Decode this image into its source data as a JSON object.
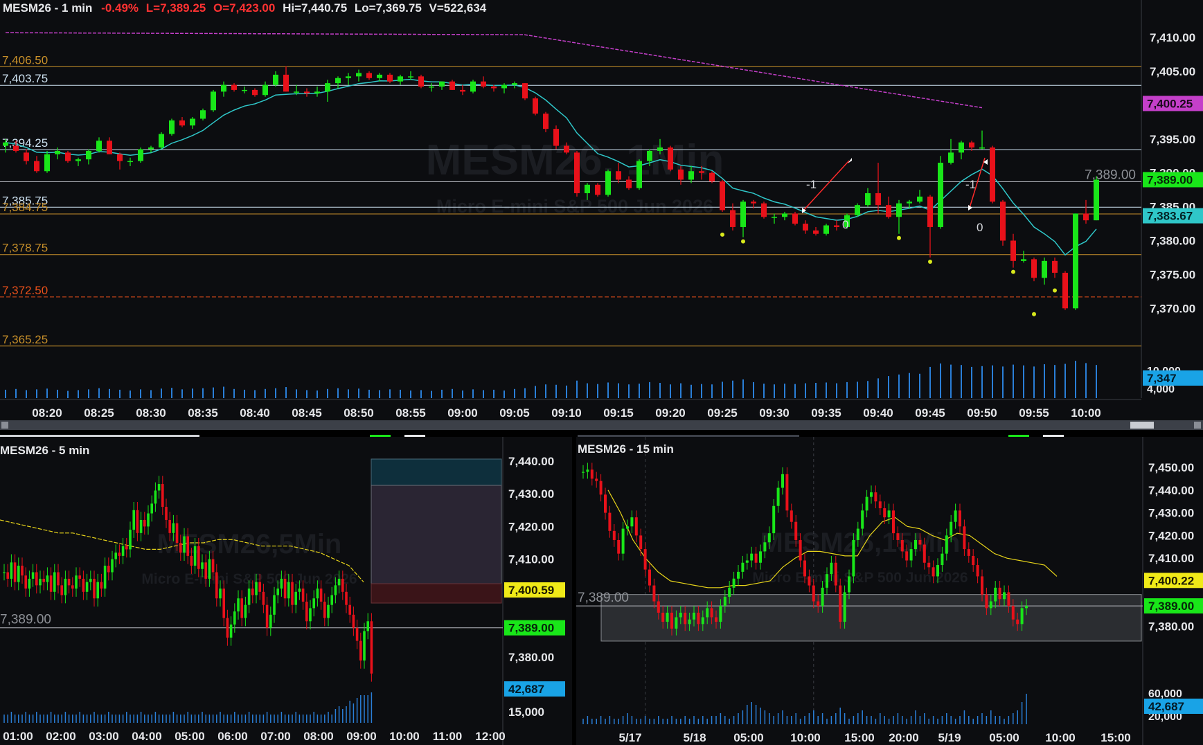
{
  "colors": {
    "up": "#19e619",
    "down": "#e8111a",
    "background": "#0c0d10",
    "level": "#c8902a",
    "level_light": "#cfe3f2",
    "ema_main": "#2fc7c9",
    "sma_main": "#c43fc9",
    "ema_small": "#e6d31a",
    "vol": "#2a7fd8"
  },
  "main": {
    "header": {
      "symbol": "MESM26 - 1 min",
      "change": "-0.49%",
      "last": "L=7,389.25",
      "open": "O=7,423.00",
      "high": "Hi=7,440.75",
      "low": "Lo=7,369.75",
      "volume": "V=522,634"
    },
    "watermark": {
      "title": "MESM26, 1Min",
      "subtitle": "Micro E-mini S&P 500 Jun 2026"
    },
    "level_lines": [
      {
        "label": "7,406.50",
        "value": 7406.5,
        "color": "#c8902a"
      },
      {
        "label": "7,403.75",
        "value": 7403.75,
        "color": "#cfe3f2"
      },
      {
        "label": "7,394.25",
        "value": 7394.25,
        "color": "#cfe3f2"
      },
      {
        "label": "7,385.75",
        "value": 7385.75,
        "color": "#cfe3f2"
      },
      {
        "label": "7,384.75",
        "value": 7384.75,
        "color": "#c8902a"
      },
      {
        "label": "7,378.75",
        "value": 7378.75,
        "color": "#c8902a"
      },
      {
        "label": "7,372.50",
        "value": 7372.5,
        "color": "#e8501a"
      },
      {
        "label": "7,365.25",
        "value": 7365.25,
        "color": "#c8902a"
      }
    ],
    "price_line": {
      "label": "7,389.00",
      "value": 7389.0
    },
    "y_ticks": [
      "7,410.00",
      "7,405.00",
      "7,395.00",
      "7,390.00",
      "7,385.00",
      "7,380.00",
      "7,375.00",
      "7,370.00"
    ],
    "badges": [
      {
        "label": "7,400.25",
        "value": 7400.25,
        "bg": "#c43fc9",
        "fg": "#1a0a1c"
      },
      {
        "label": "7,389.00",
        "value": 7389.0,
        "bg": "#19e619",
        "fg": "#06240a"
      },
      {
        "label": "7,383.67",
        "value": 7383.67,
        "bg": "#2fc7c9",
        "fg": "#032224"
      }
    ],
    "vol_ticks": [
      "10,000",
      "4,000"
    ],
    "vol_badge": "7,347",
    "x_ticks": [
      "08:20",
      "08:25",
      "08:30",
      "08:35",
      "08:40",
      "08:45",
      "08:50",
      "08:55",
      "09:00",
      "09:05",
      "09:10",
      "09:15",
      "09:20",
      "09:25",
      "09:30",
      "09:35",
      "09:40",
      "09:45",
      "09:50",
      "09:55",
      "10:00"
    ],
    "trade_marks": [
      "-1",
      "0",
      "-1",
      "0"
    ],
    "candles": [
      [
        7394.0,
        7395.0,
        7393.0,
        7394.5
      ],
      [
        7394.0,
        7394.75,
        7393.0,
        7393.25
      ],
      [
        7393.0,
        7393.5,
        7391.25,
        7391.75
      ],
      [
        7391.75,
        7392.5,
        7390.0,
        7390.25
      ],
      [
        7390.25,
        7393.25,
        7390.0,
        7392.75
      ],
      [
        7392.75,
        7393.75,
        7392.0,
        7393.25
      ],
      [
        7393.0,
        7393.25,
        7391.5,
        7391.75
      ],
      [
        7391.75,
        7392.25,
        7391.0,
        7392.0
      ],
      [
        7392.0,
        7393.5,
        7391.25,
        7393.25
      ],
      [
        7393.25,
        7395.25,
        7393.0,
        7394.75
      ],
      [
        7394.75,
        7395.25,
        7392.75,
        7392.75
      ],
      [
        7392.75,
        7393.0,
        7390.5,
        7391.75
      ],
      [
        7391.75,
        7392.25,
        7391.0,
        7391.75
      ],
      [
        7391.75,
        7393.75,
        7391.5,
        7393.5
      ],
      [
        7393.5,
        7394.0,
        7393.0,
        7393.75
      ],
      [
        7393.75,
        7396.0,
        7393.5,
        7395.75
      ],
      [
        7395.75,
        7398.0,
        7395.5,
        7397.75
      ],
      [
        7397.75,
        7398.25,
        7396.75,
        7397.0
      ],
      [
        7397.0,
        7398.25,
        7396.5,
        7398.0
      ],
      [
        7398.0,
        7399.5,
        7397.75,
        7399.25
      ],
      [
        7399.25,
        7402.25,
        7399.0,
        7402.0
      ],
      [
        7402.0,
        7403.5,
        7401.25,
        7403.0
      ],
      [
        7403.0,
        7403.25,
        7402.0,
        7402.25
      ],
      [
        7402.25,
        7402.75,
        7401.75,
        7402.25
      ],
      [
        7402.25,
        7402.5,
        7401.25,
        7401.5
      ],
      [
        7401.5,
        7403.5,
        7401.25,
        7403.0
      ],
      [
        7403.0,
        7405.0,
        7402.75,
        7404.5
      ],
      [
        7404.5,
        7405.75,
        7402.0,
        7402.0
      ],
      [
        7402.0,
        7403.0,
        7401.5,
        7402.0
      ],
      [
        7402.0,
        7402.5,
        7401.25,
        7401.75
      ],
      [
        7401.75,
        7402.75,
        7401.25,
        7402.0
      ],
      [
        7402.0,
        7403.75,
        7400.5,
        7403.25
      ],
      [
        7403.25,
        7404.25,
        7402.5,
        7404.0
      ],
      [
        7404.0,
        7404.75,
        7403.0,
        7404.25
      ],
      [
        7404.25,
        7405.25,
        7403.5,
        7404.75
      ],
      [
        7404.75,
        7405.0,
        7403.75,
        7404.0
      ],
      [
        7404.0,
        7404.75,
        7403.5,
        7404.5
      ],
      [
        7404.5,
        7404.75,
        7403.25,
        7403.5
      ],
      [
        7403.5,
        7404.5,
        7403.0,
        7404.25
      ],
      [
        7404.25,
        7405.0,
        7403.75,
        7404.25
      ],
      [
        7404.25,
        7404.5,
        7402.5,
        7402.75
      ],
      [
        7402.75,
        7403.25,
        7402.0,
        7402.75
      ],
      [
        7402.75,
        7403.5,
        7402.25,
        7403.5
      ],
      [
        7403.5,
        7403.75,
        7402.25,
        7402.25
      ],
      [
        7402.25,
        7403.0,
        7401.5,
        7402.0
      ],
      [
        7402.0,
        7403.75,
        7401.75,
        7403.5
      ],
      [
        7403.5,
        7404.25,
        7402.5,
        7402.75
      ],
      [
        7402.75,
        7403.0,
        7402.0,
        7402.5
      ],
      [
        7402.5,
        7403.25,
        7401.75,
        7403.0
      ],
      [
        7403.0,
        7403.5,
        7402.5,
        7403.25
      ],
      [
        7403.25,
        7403.25,
        7400.75,
        7401.0
      ],
      [
        7401.0,
        7401.25,
        7398.5,
        7398.75
      ],
      [
        7398.75,
        7399.0,
        7396.0,
        7396.5
      ],
      [
        7396.5,
        7397.0,
        7393.5,
        7394.0
      ],
      [
        7394.0,
        7394.5,
        7392.75,
        7393.0
      ],
      [
        7393.0,
        7393.25,
        7386.5,
        7387.0
      ],
      [
        7387.0,
        7388.5,
        7386.0,
        7388.25
      ],
      [
        7388.25,
        7388.5,
        7386.5,
        7386.75
      ],
      [
        7386.75,
        7390.5,
        7386.5,
        7390.25
      ],
      [
        7390.25,
        7391.5,
        7388.5,
        7389.0
      ],
      [
        7389.0,
        7389.5,
        7387.5,
        7387.75
      ],
      [
        7387.75,
        7392.0,
        7387.5,
        7391.75
      ],
      [
        7391.75,
        7393.5,
        7391.0,
        7393.25
      ],
      [
        7393.25,
        7395.0,
        7392.75,
        7393.75
      ],
      [
        7393.75,
        7394.0,
        7390.25,
        7390.5
      ],
      [
        7390.5,
        7391.0,
        7388.25,
        7389.0
      ],
      [
        7389.0,
        7391.0,
        7388.5,
        7390.25
      ],
      [
        7390.25,
        7391.0,
        7389.0,
        7390.0
      ],
      [
        7390.0,
        7390.25,
        7388.5,
        7388.75
      ],
      [
        7388.75,
        7389.0,
        7384.25,
        7384.5
      ],
      [
        7384.5,
        7385.5,
        7381.5,
        7382.0
      ],
      [
        7382.0,
        7386.0,
        7380.5,
        7385.75
      ],
      [
        7385.75,
        7386.0,
        7384.75,
        7385.5
      ],
      [
        7385.5,
        7385.75,
        7383.25,
        7383.5
      ],
      [
        7383.5,
        7384.0,
        7382.5,
        7383.5
      ],
      [
        7383.5,
        7384.25,
        7383.0,
        7384.0
      ],
      [
        7384.0,
        7384.25,
        7382.25,
        7382.5
      ],
      [
        7382.5,
        7383.0,
        7381.0,
        7381.5
      ],
      [
        7381.5,
        7382.0,
        7380.75,
        7381.0
      ],
      [
        7381.0,
        7382.5,
        7380.75,
        7382.25
      ],
      [
        7382.25,
        7383.0,
        7381.5,
        7382.0
      ],
      [
        7382.0,
        7384.0,
        7381.75,
        7383.75
      ],
      [
        7383.75,
        7385.5,
        7383.5,
        7385.25
      ],
      [
        7385.25,
        7387.75,
        7385.0,
        7387.0
      ],
      [
        7387.0,
        7391.5,
        7384.0,
        7385.25
      ],
      [
        7385.25,
        7386.5,
        7383.25,
        7383.5
      ],
      [
        7383.5,
        7386.0,
        7381.0,
        7385.5
      ],
      [
        7385.5,
        7386.0,
        7384.75,
        7385.75
      ],
      [
        7385.75,
        7387.5,
        7385.5,
        7386.5
      ],
      [
        7386.5,
        7386.75,
        7377.5,
        7382.0
      ],
      [
        7382.0,
        7392.5,
        7381.75,
        7391.5
      ],
      [
        7391.5,
        7395.0,
        7391.25,
        7393.0
      ],
      [
        7393.0,
        7394.75,
        7392.0,
        7394.5
      ],
      [
        7394.5,
        7394.75,
        7393.25,
        7393.75
      ],
      [
        7393.75,
        7396.25,
        7393.5,
        7393.75
      ],
      [
        7393.75,
        7394.0,
        7385.5,
        7385.75
      ],
      [
        7385.75,
        7386.0,
        7379.25,
        7380.0
      ],
      [
        7380.0,
        7381.0,
        7376.0,
        7377.0
      ],
      [
        7377.0,
        7378.5,
        7376.75,
        7377.25
      ],
      [
        7377.25,
        7377.5,
        7374.0,
        7374.5
      ],
      [
        7374.5,
        7377.5,
        7373.5,
        7377.0
      ],
      [
        7377.0,
        7377.5,
        7374.5,
        7375.25
      ],
      [
        7375.25,
        7375.5,
        7369.75,
        7370.0
      ],
      [
        7370.0,
        7384.0,
        7369.75,
        7384.0
      ],
      [
        7384.0,
        7386.0,
        7382.5,
        7383.0
      ],
      [
        7383.0,
        7389.5,
        7383.0,
        7389.0
      ]
    ],
    "volumes": [
      2200,
      2400,
      2100,
      2300,
      2500,
      2200,
      1900,
      2100,
      2300,
      2600,
      2400,
      2200,
      2000,
      2300,
      2100,
      2500,
      2700,
      2300,
      2500,
      2600,
      2800,
      3000,
      2400,
      2200,
      2100,
      2400,
      2600,
      2900,
      2300,
      2100,
      2000,
      2400,
      2600,
      2300,
      2500,
      2200,
      2100,
      2300,
      2200,
      2000,
      2100,
      1900,
      2200,
      2400,
      2000,
      2300,
      2100,
      2200,
      2000,
      2400,
      2600,
      3200,
      3600,
      3500,
      3300,
      4600,
      3900,
      3700,
      4100,
      3900,
      3600,
      3800,
      4200,
      4000,
      3600,
      3900,
      3500,
      3700,
      3600,
      4300,
      4600,
      4900,
      4200,
      3800,
      3600,
      3800,
      3700,
      3900,
      4000,
      4100,
      3900,
      4200,
      4300,
      4500,
      5200,
      5800,
      6200,
      6600,
      6400,
      8200,
      9100,
      8800,
      8700,
      8200,
      8400,
      8600,
      8300,
      8800,
      8600,
      8300,
      8900,
      8700,
      9000,
      9800,
      9200,
      8700
    ]
  },
  "bottom_left": {
    "header": "MESM26 - 5 min",
    "watermark": {
      "title": "MESM26,5Min",
      "subtitle": "Micro E-mini S&P 500 Jun 2026"
    },
    "price_line_label": "7,389.00",
    "y_ticks": [
      "7,440.00",
      "7,430.00",
      "7,420.00",
      "7,410.00",
      "7,380.00"
    ],
    "badges": [
      {
        "label": "7,400.59",
        "value": 7400.59,
        "bg": "#f0ea18",
        "fg": "#1c1a02"
      },
      {
        "label": "7,389.00",
        "value": 7389.0,
        "bg": "#19e619",
        "fg": "#06240a"
      }
    ],
    "vol_badge": "42,687",
    "vol_tick": "15,000",
    "x_ticks": [
      "01:00",
      "02:00",
      "03:00",
      "04:00",
      "05:00",
      "06:00",
      "07:00",
      "08:00",
      "09:00",
      "10:00",
      "11:00",
      "12:00"
    ],
    "closes": [
      7406,
      7404,
      7409,
      7403,
      7408,
      7405,
      7401,
      7404,
      7406,
      7402,
      7404,
      7403,
      7405,
      7400,
      7406,
      7402,
      7399,
      7404,
      7402,
      7401,
      7405,
      7404,
      7400,
      7403,
      7404,
      7398,
      7403,
      7401,
      7408,
      7406,
      7410,
      7412,
      7411,
      7414,
      7413,
      7419,
      7425,
      7418,
      7422,
      7420,
      7424,
      7427,
      7431,
      7433,
      7426,
      7422,
      7418,
      7421,
      7415,
      7412,
      7417,
      7411,
      7408,
      7414,
      7407,
      7409,
      7404,
      7410,
      7406,
      7398,
      7401,
      7392,
      7386,
      7390,
      7394,
      7398,
      7392,
      7396,
      7401,
      7399,
      7403,
      7400,
      7396,
      7389,
      7393,
      7399,
      7401,
      7404,
      7398,
      7403,
      7396,
      7400,
      7401,
      7397,
      7391,
      7395,
      7398,
      7401,
      7397,
      7392,
      7396,
      7399,
      7402,
      7404,
      7400,
      7396,
      7393,
      7389,
      7385,
      7379,
      7388,
      7391,
      7375
    ],
    "ema": [
      7422,
      7421,
      7420,
      7419,
      7418,
      7418,
      7417,
      7416,
      7415,
      7414,
      7413,
      7413,
      7414,
      7415,
      7415,
      7416,
      7416,
      7415,
      7414,
      7414,
      7414,
      7413,
      7412,
      7410,
      7408,
      7403
    ],
    "volumes": [
      3,
      3,
      4,
      3,
      3,
      3,
      4,
      3,
      3,
      4,
      3,
      3,
      3,
      4,
      3,
      3,
      3,
      4,
      3,
      3,
      3,
      4,
      3,
      3,
      3,
      4,
      3,
      3,
      3,
      4,
      3,
      3,
      3,
      3,
      4,
      3,
      3,
      3,
      4,
      3,
      3,
      3,
      4,
      3,
      3,
      3,
      3,
      4,
      3,
      3,
      3,
      4,
      3,
      3,
      3,
      4,
      3,
      3,
      3,
      3,
      4,
      3,
      3,
      3,
      4,
      3,
      3,
      3,
      4,
      3,
      3,
      3,
      3,
      4,
      3,
      3,
      3,
      4,
      3,
      3,
      3,
      4,
      3,
      3,
      3,
      3,
      4,
      3,
      3,
      3,
      4,
      3,
      5,
      6,
      5,
      6,
      8,
      7,
      9,
      10,
      10,
      10,
      11
    ]
  },
  "bottom_right": {
    "header": "MESM26 - 15 min",
    "watermark": {
      "title": "MESM26,15Min",
      "subtitle": "Micro E-mini S&P 500 Jun 2026"
    },
    "price_line_label": "7,389.00",
    "y_ticks": [
      "7,450.00",
      "7,440.00",
      "7,430.00",
      "7,420.00",
      "7,410.00",
      "7,380.00"
    ],
    "badges": [
      {
        "label": "7,400.22",
        "value": 7400.22,
        "bg": "#f0ea18",
        "fg": "#1c1a02"
      },
      {
        "label": "7,389.00",
        "value": 7389.0,
        "bg": "#19e619",
        "fg": "#06240a"
      }
    ],
    "vol_badge": "42,687",
    "vol_ticks": [
      "60,000",
      "20,000"
    ],
    "x_ticks": [
      "5/17",
      "5/18",
      "05:00",
      "10:00",
      "15:00",
      "20:00",
      "5/19",
      "05:00",
      "10:00",
      "15:00"
    ],
    "closes": [
      7448,
      7449,
      7445,
      7444,
      7438,
      7430,
      7422,
      7418,
      7412,
      7423,
      7424,
      7428,
      7420,
      7414,
      7405,
      7398,
      7391,
      7386,
      7382,
      7386,
      7379,
      7384,
      7386,
      7381,
      7383,
      7386,
      7381,
      7384,
      7388,
      7384,
      7382,
      7389,
      7393,
      7397,
      7401,
      7404,
      7408,
      7409,
      7412,
      7408,
      7413,
      7417,
      7421,
      7433,
      7441,
      7447,
      7431,
      7426,
      7418,
      7409,
      7402,
      7398,
      7391,
      7389,
      7397,
      7403,
      7408,
      7398,
      7382,
      7395,
      7402,
      7418,
      7423,
      7431,
      7437,
      7439,
      7435,
      7432,
      7428,
      7431,
      7421,
      7418,
      7413,
      7409,
      7414,
      7418,
      7416,
      7408,
      7406,
      7402,
      7407,
      7412,
      7420,
      7426,
      7431,
      7424,
      7414,
      7411,
      7407,
      7402,
      7394,
      7388,
      7391,
      7397,
      7392,
      7395,
      7389,
      7383,
      7381,
      7388,
      7389
    ],
    "sma": [
      7440,
      7430,
      7418,
      7410,
      7404,
      7400,
      7399,
      7398,
      7397,
      7397,
      7398,
      7398,
      7399,
      7400,
      7406,
      7410,
      7413,
      7413,
      7412,
      7411,
      7411,
      7420,
      7426,
      7428,
      7424,
      7423,
      7420,
      7418,
      7421,
      7420,
      7416,
      7412,
      7410,
      7409,
      7408,
      7407,
      7402
    ],
    "volumes": [
      2,
      3,
      2,
      2,
      3,
      2,
      3,
      2,
      2,
      3,
      4,
      3,
      2,
      2,
      3,
      2,
      2,
      3,
      2,
      2,
      3,
      2,
      2,
      3,
      2,
      3,
      2,
      3,
      2,
      3,
      3,
      4,
      3,
      2,
      3,
      4,
      5,
      7,
      8,
      7,
      6,
      5,
      4,
      3,
      4,
      5,
      3,
      3,
      4,
      2,
      3,
      4,
      5,
      3,
      4,
      2,
      3,
      4,
      6,
      4,
      2,
      3,
      4,
      5,
      3,
      3,
      2,
      4,
      3,
      2,
      3,
      4,
      3,
      2,
      3,
      5,
      3,
      4,
      2,
      3,
      2,
      3,
      4,
      3,
      2,
      3,
      5,
      3,
      2,
      3,
      4,
      3,
      5,
      3,
      3,
      2,
      3,
      4,
      5,
      8,
      11
    ],
    "range_box": {
      "top": 7394.0,
      "bottom": 7373.5
    },
    "dividers": [
      4,
      42
    ]
  }
}
